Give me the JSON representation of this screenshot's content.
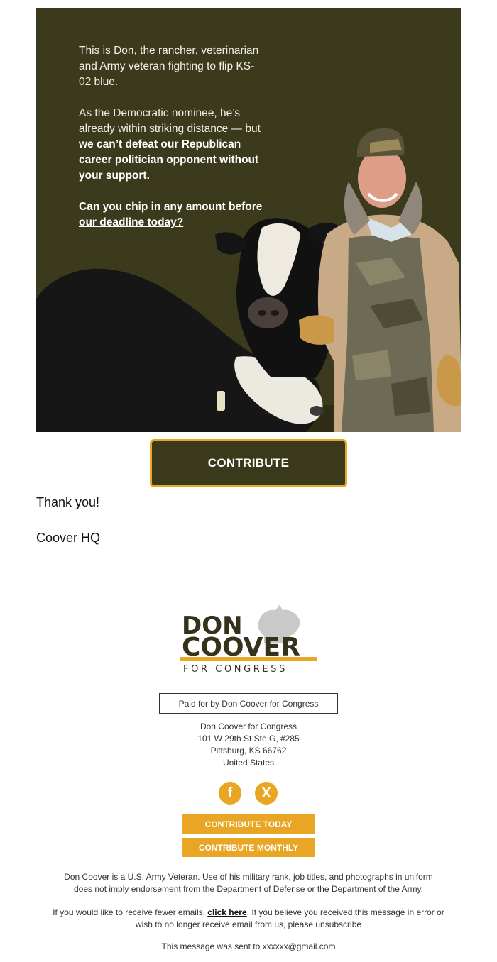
{
  "hero": {
    "paragraph1": "This is Don, the rancher, veterinarian and Army veteran fighting to flip KS-02 blue.",
    "paragraph2_start": "As the Democratic nominee, he’s already within striking distance — but ",
    "paragraph2_bold": "we can’t defeat our Republican career politician opponent without your support.",
    "link_text": "Can you chip in any amount before our deadline today?",
    "colors": {
      "background": "#3c3a1c",
      "text": "#f2f0e6"
    }
  },
  "contribute_button": {
    "label": "CONTRIBUTE",
    "colors": {
      "fill": "#3b391c",
      "border": "#e8a624"
    }
  },
  "body": {
    "thanks": "Thank you!",
    "signature": "Coover HQ"
  },
  "logo": {
    "line1": "DON",
    "line2": "COOVER",
    "tagline": "FOR CONGRESS",
    "accent": "#e8a624"
  },
  "footer": {
    "paid_for": "Paid for by Don Coover for Congress",
    "address": [
      "Don Coover for Congress",
      "101 W 29th St Ste G, #285",
      "Pittsburg, KS 66762",
      "United States"
    ],
    "social": {
      "facebook_icon": "f",
      "x_icon": "X"
    },
    "buttons": {
      "contribute_today": "CONTRIBUTE TODAY",
      "contribute_monthly": "CONTRIBUTE MONTHLY"
    },
    "disclaimer": "Don Coover is a U.S. Army Veteran. Use of his military rank, job titles, and photographs in uniform does not imply endorsement from the Department of Defense or the Department of the Army.",
    "fewer_emails_before": "If you would like to receive fewer emails, ",
    "click_here": "click here",
    "fewer_emails_after": ". If you believe you received this message in error or wish to no longer receive email from us, please unsubscribe",
    "sent_to": "This message was sent to xxxxxx@gmail.com"
  }
}
